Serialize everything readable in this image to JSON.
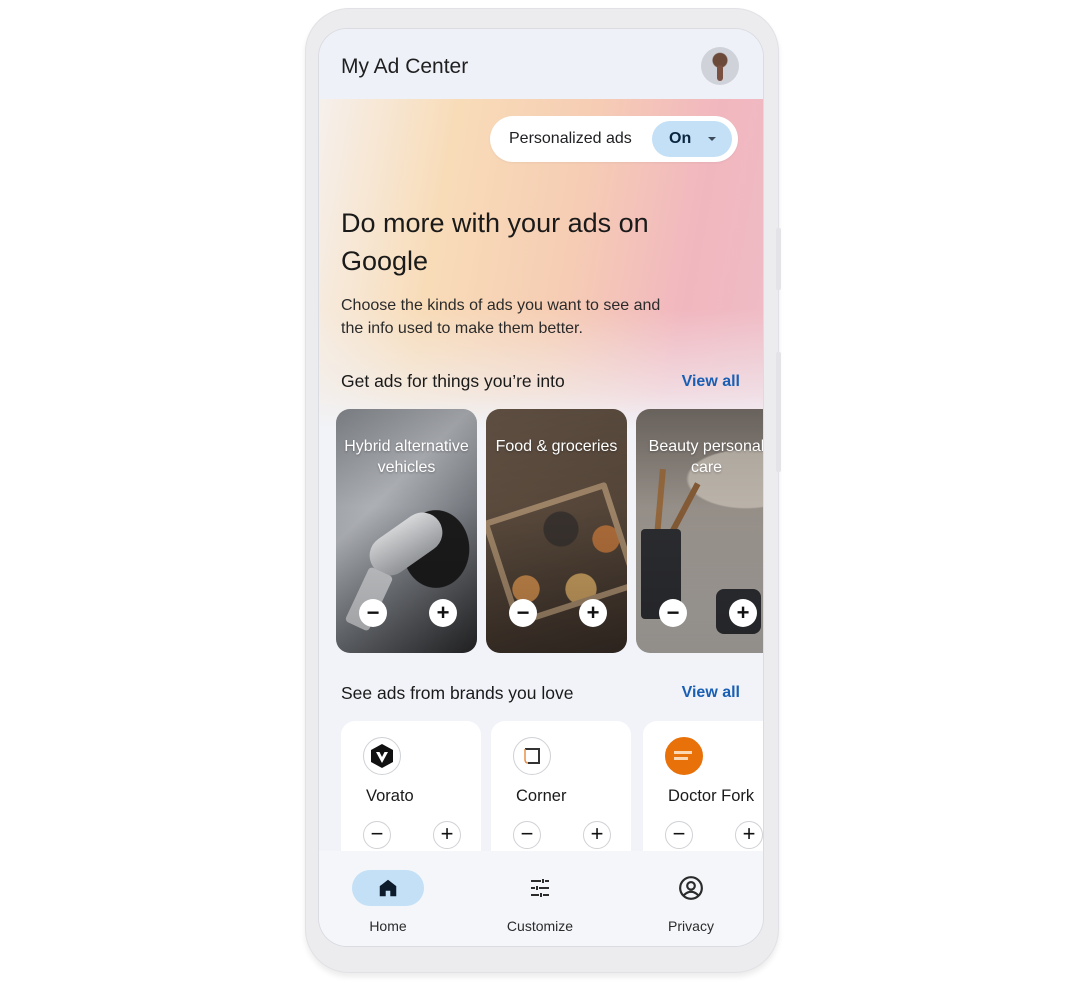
{
  "app": {
    "title": "My Ad Center",
    "avatar_icon": "user-avatar"
  },
  "personalized_ads": {
    "label": "Personalized ads",
    "value": "On",
    "caret_icon": "dropdown-caret"
  },
  "hero": {
    "headline": "Do more with your ads on Google",
    "subtext": "Choose the kinds of ads you want to see and the info used to make them better."
  },
  "topics_section": {
    "title": "Get ads for things you’re into",
    "view_all": "View all",
    "items": [
      {
        "label": "Hybrid alternative vehicles",
        "minus": "−",
        "plus": "+"
      },
      {
        "label": "Food & groceries",
        "minus": "−",
        "plus": "+"
      },
      {
        "label": "Beauty personal care",
        "minus": "−",
        "plus": "+"
      }
    ]
  },
  "brands_section": {
    "title": "See ads from brands you love",
    "view_all": "View all",
    "items": [
      {
        "name": "Vorato",
        "logo_color": "#111111",
        "minus": "−",
        "plus": "+"
      },
      {
        "name": "Corner",
        "logo_color": "#333333",
        "minus": "−",
        "plus": "+"
      },
      {
        "name": "Doctor Fork",
        "logo_color": "#e8710a",
        "minus": "−",
        "plus": "+"
      }
    ]
  },
  "bottom_nav": {
    "items": [
      {
        "label": "Home",
        "icon": "home-icon",
        "active": true
      },
      {
        "label": "Customize",
        "icon": "tune-icon",
        "active": false
      },
      {
        "label": "Privacy",
        "icon": "account-circle-icon",
        "active": false
      }
    ]
  },
  "colors": {
    "accent": "#1a5fb4",
    "toggle_bg": "#c3e0f6",
    "screen_bg": "#f1f3f8"
  }
}
